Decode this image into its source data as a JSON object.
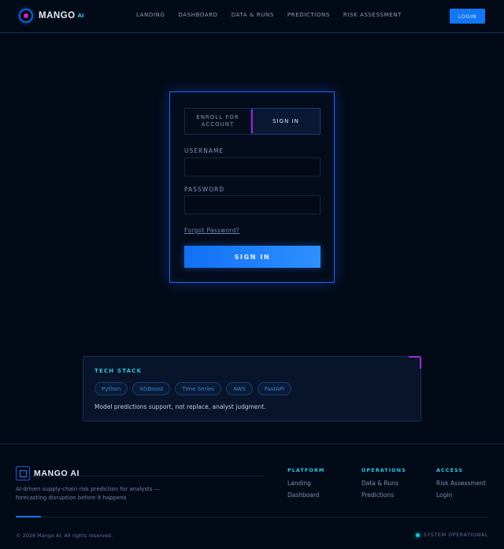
{
  "nav": {
    "brand": "MANGO",
    "brand_suffix": "AI",
    "links": [
      "LANDING",
      "DASHBOARD",
      "DATA & RUNS",
      "PREDICTIONS",
      "RISK ASSESSMENT"
    ],
    "login": "LOGIN"
  },
  "auth": {
    "tab_enroll": "ENROLL FOR\nACCOUNT",
    "tab_signin": "SIGN IN",
    "username_label": "USERNAME",
    "username_value": "",
    "password_label": "PASSWORD",
    "password_value": "",
    "forgot": "Forgot Password?",
    "submit": "SIGN IN"
  },
  "tech": {
    "title": "TECH STACK",
    "chips": [
      "Python",
      "XGBoost",
      "Time Series",
      "AWS",
      "FastAPI"
    ],
    "note": "Model predictions support, not replace, analyst judgment."
  },
  "footer": {
    "brand": "MANGO AI",
    "tagline": "AI-driven supply-chain risk prediction for analysts — forecasting disruption before it happens",
    "columns": [
      {
        "title": "PLATFORM",
        "links": [
          "Landing",
          "Dashboard"
        ]
      },
      {
        "title": "OPERATIONS",
        "links": [
          "Data & Runs",
          "Predictions"
        ]
      },
      {
        "title": "ACCESS",
        "links": [
          "Risk Assessment",
          "Login"
        ]
      }
    ],
    "copyright": "© 2026 Mango AI. All rights reserved.",
    "status": "SYSTEM OPERATIONAL"
  },
  "colors": {
    "background": "#030a17",
    "accent_blue": "#1177f5",
    "accent_cyan": "#2fc4e6",
    "accent_magenta": "#a41fd6"
  }
}
